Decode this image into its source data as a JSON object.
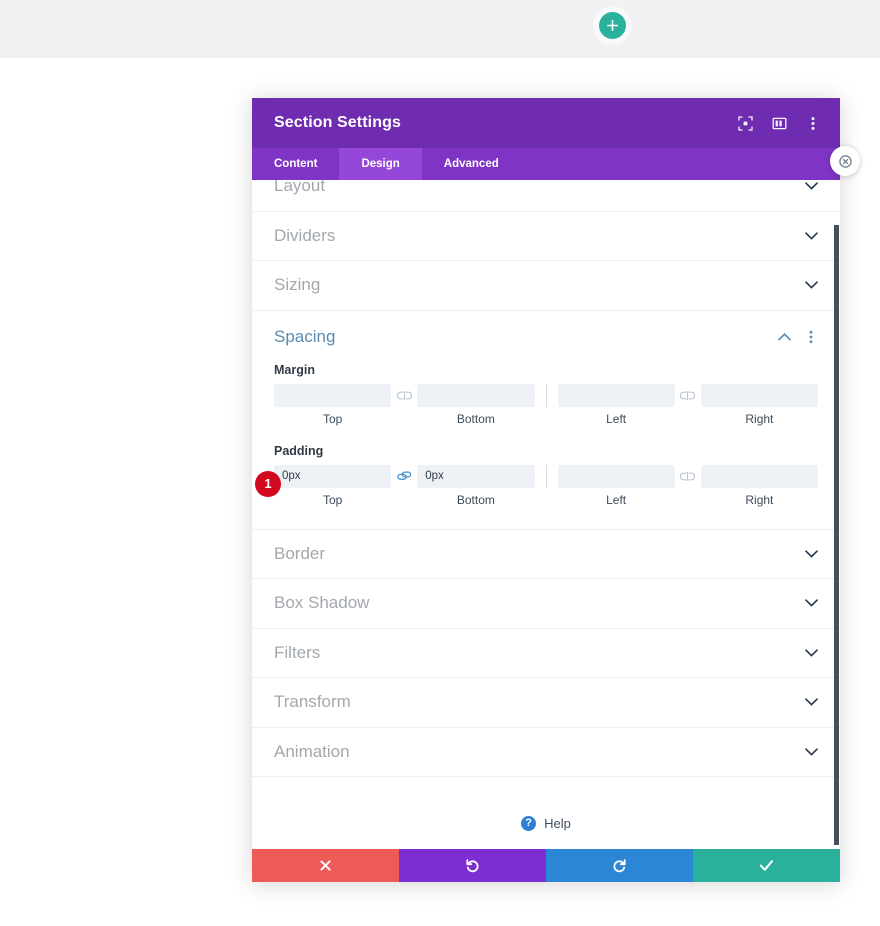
{
  "page": {
    "add_section_button": "add-section",
    "accent_green": "#2ab19b"
  },
  "modal": {
    "title": "Section Settings",
    "header_icons": [
      {
        "name": "expand-icon",
        "label": "Expand"
      },
      {
        "name": "layout-columns-icon",
        "label": "Layout"
      },
      {
        "name": "more-vertical-icon",
        "label": "More"
      }
    ],
    "close_label": "Close",
    "tabs": [
      {
        "label": "Content",
        "active": false
      },
      {
        "label": "Design",
        "active": true
      },
      {
        "label": "Advanced",
        "active": false
      }
    ],
    "colors": {
      "header": "#6f2cb0",
      "tabbar": "#8034c6",
      "tab_active": "#9447d8"
    }
  },
  "sections_above": [
    {
      "title": "Layout",
      "state": "collapsed"
    },
    {
      "title": "Dividers",
      "state": "collapsed"
    },
    {
      "title": "Sizing",
      "state": "collapsed"
    }
  ],
  "spacing": {
    "title": "Spacing",
    "collapse_icon": "chevron-up-icon",
    "menu_icon": "more-vertical-icon",
    "step_badge": "1",
    "margin": {
      "label": "Margin",
      "linked": false,
      "link_icon_left": "link-broken-icon",
      "link_icon_right": "link-broken-icon",
      "fields": [
        {
          "sublabel": "Top",
          "value": "",
          "placeholder": ""
        },
        {
          "sublabel": "Bottom",
          "value": "",
          "placeholder": ""
        },
        {
          "sublabel": "Left",
          "value": "",
          "placeholder": ""
        },
        {
          "sublabel": "Right",
          "value": "",
          "placeholder": ""
        }
      ]
    },
    "padding": {
      "label": "Padding",
      "linked": true,
      "link_icon_left": "link-connected-icon",
      "link_icon_right": "link-broken-icon",
      "fields": [
        {
          "sublabel": "Top",
          "value": "0px",
          "placeholder": ""
        },
        {
          "sublabel": "Bottom",
          "value": "0px",
          "placeholder": ""
        },
        {
          "sublabel": "Left",
          "value": "",
          "placeholder": ""
        },
        {
          "sublabel": "Right",
          "value": "",
          "placeholder": ""
        }
      ]
    }
  },
  "sections_below": [
    {
      "title": "Border",
      "state": "collapsed"
    },
    {
      "title": "Box Shadow",
      "state": "collapsed"
    },
    {
      "title": "Filters",
      "state": "collapsed"
    },
    {
      "title": "Transform",
      "state": "collapsed"
    },
    {
      "title": "Animation",
      "state": "collapsed"
    }
  ],
  "help": {
    "label": "Help",
    "icon": "question-circle-icon"
  },
  "footer": {
    "buttons": [
      {
        "name": "cancel",
        "icon": "close-x-icon",
        "color": "#ec5b57"
      },
      {
        "name": "undo",
        "icon": "undo-arrow-icon",
        "color": "#7d2ed0"
      },
      {
        "name": "redo",
        "icon": "redo-arrow-icon",
        "color": "#2b87d6"
      },
      {
        "name": "save",
        "icon": "checkmark-icon",
        "color": "#2ab19b"
      }
    ]
  }
}
